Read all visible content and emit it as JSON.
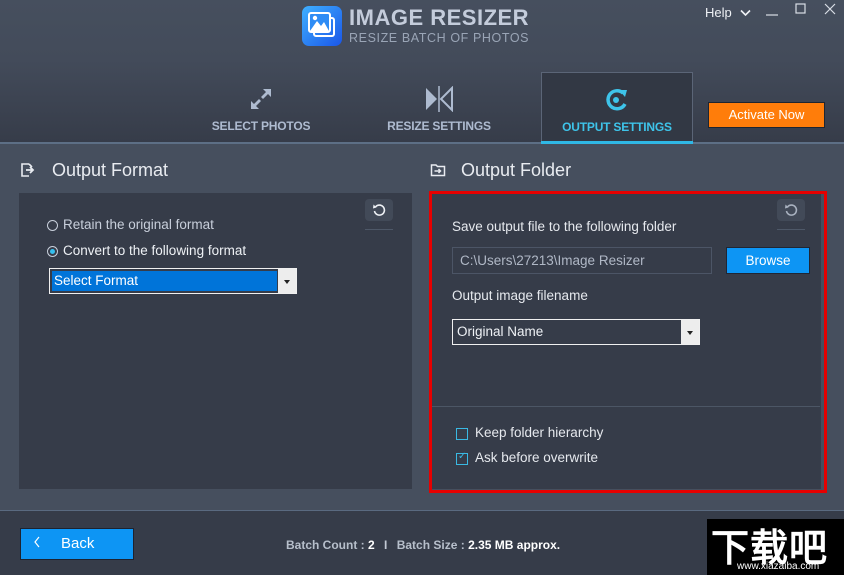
{
  "app": {
    "title": "IMAGE RESIZER",
    "subtitle": "RESIZE BATCH OF PHOTOS"
  },
  "window": {
    "help_label": "Help",
    "minimize_glyph": "—",
    "maximize_glyph": "☐",
    "close_glyph": "✕"
  },
  "tabs": [
    {
      "label": "SELECT PHOTOS",
      "icon": "expand-arrows-icon",
      "active": false
    },
    {
      "label": "RESIZE SETTINGS",
      "icon": "resize-split-icon",
      "active": false
    },
    {
      "label": "OUTPUT SETTINGS",
      "icon": "refresh-circle-icon",
      "active": true
    }
  ],
  "activate_button": "Activate Now",
  "output_format": {
    "title": "Output Format",
    "options": [
      {
        "label": "Retain the original format",
        "selected": false
      },
      {
        "label": "Convert to the following format",
        "selected": true
      }
    ],
    "format_select": {
      "value": "Select Format"
    }
  },
  "output_folder": {
    "title": "Output Folder",
    "save_label": "Save output file to the following folder",
    "path_value": "C:\\Users\\27213\\Image Resizer",
    "browse_label": "Browse",
    "filename_label": "Output image filename",
    "filename_select": {
      "value": "Original Name"
    },
    "checkboxes": [
      {
        "label": "Keep folder hierarchy",
        "checked": false
      },
      {
        "label": "Ask before overwrite",
        "checked": true
      }
    ]
  },
  "footer": {
    "back_label": "Back",
    "batch_count_label": "Batch Count :",
    "batch_count_value": "2",
    "separator": "I",
    "batch_size_label": "Batch Size :",
    "batch_size_value": "2.35 MB approx."
  },
  "watermark": {
    "text": "下载吧",
    "url_text": "www.xiazaiba.com"
  },
  "colors": {
    "accent_blue": "#0d95f4",
    "active_tab": "#3ec4ea",
    "activate_orange": "#ff7d0a",
    "highlight_red": "#e60000"
  }
}
